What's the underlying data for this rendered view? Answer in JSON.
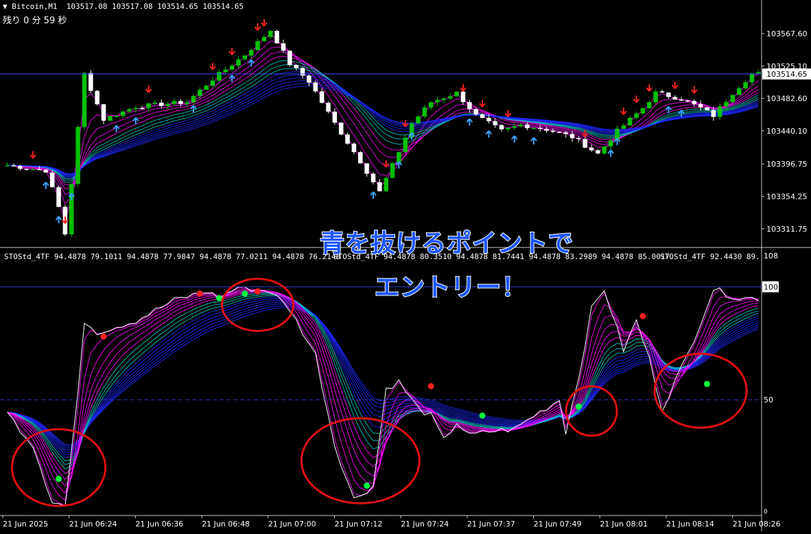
{
  "window": {
    "symbol_label": "Bitcoin,M1",
    "ohlc": "103517.08 103517.08 103514.65 103514.65",
    "timer": "残り 0 分 59 秒"
  },
  "indicator": {
    "label_1": "STOStd_4TF 94.4878 79.1011 94.4878 77.9847 94.4878 77.0211 94.4878 76.2148",
    "label_2": "STOStd_4TF 94.4878 80.3510 94.4878 81.7441 94.4878 83.2989 94.4878 85.0017",
    "label_3": "STOStd_4TF 92.4430 89."
  },
  "annotation": {
    "line1": "青を抜けるポイントで",
    "line2": "エントリー！"
  },
  "colors": {
    "background": "#000000",
    "bull": "#00c000",
    "bear": "#ffffff",
    "ma_fast": "#ff00ff",
    "ma_mid": "#00c8c8",
    "ma_slow": "#1e28ff",
    "circle": "#e01010",
    "dot_green": "#00ff40",
    "dot_red": "#ff2020",
    "callout_text": "#1e56ff"
  },
  "chart_data": [
    {
      "type": "candlestick",
      "symbol": "Bitcoin",
      "timeframe": "M1",
      "ylim": [
        103290,
        103608
      ],
      "y_ticks": [
        "103567.60",
        "103525.10",
        "103482.60",
        "103440.10",
        "103396.75",
        "103354.25",
        "103311.75"
      ],
      "current_price": "103514.65",
      "close_path": [
        [
          0,
          103395
        ],
        [
          6,
          103388
        ],
        [
          8,
          103340
        ],
        [
          9,
          103305
        ],
        [
          10,
          103372
        ],
        [
          12,
          103515
        ],
        [
          15,
          103455
        ],
        [
          20,
          103472
        ],
        [
          28,
          103478
        ],
        [
          32,
          103508
        ],
        [
          37,
          103540
        ],
        [
          41,
          103572
        ],
        [
          44,
          103528
        ],
        [
          47,
          103505
        ],
        [
          51,
          103450
        ],
        [
          55,
          103400
        ],
        [
          58,
          103360
        ],
        [
          60,
          103395
        ],
        [
          63,
          103450
        ],
        [
          66,
          103478
        ],
        [
          70,
          103490
        ],
        [
          73,
          103460
        ],
        [
          77,
          103440
        ],
        [
          80,
          103448
        ],
        [
          84,
          103442
        ],
        [
          88,
          103432
        ],
        [
          92,
          103410
        ],
        [
          95,
          103440
        ],
        [
          99,
          103470
        ],
        [
          101,
          103490
        ],
        [
          105,
          103482
        ],
        [
          108,
          103470
        ],
        [
          110,
          103460
        ],
        [
          113,
          103490
        ],
        [
          116,
          103515
        ]
      ],
      "buy_arrows": [
        6,
        8,
        10,
        17,
        20,
        29,
        35,
        38,
        57,
        61,
        63,
        72,
        75,
        79,
        82,
        94,
        95,
        103,
        105
      ],
      "sell_arrows": [
        4,
        9,
        22,
        32,
        35,
        39,
        40,
        59,
        62,
        71,
        74,
        78,
        90,
        96,
        98,
        100,
        104,
        107
      ]
    },
    {
      "type": "line",
      "name": "STOStd_4TF",
      "ylim": [
        0,
        108
      ],
      "y_ticks": [
        "108",
        "100",
        "50",
        "0"
      ],
      "x_ticks": [
        "21 Jun 2025",
        "21 Jun 06:24",
        "21 Jun 06:36",
        "21 Jun 06:48",
        "21 Jun 07:00",
        "21 Jun 07:12",
        "21 Jun 07:24",
        "21 Jun 07:37",
        "21 Jun 07:49",
        "21 Jun 08:01",
        "21 Jun 08:14",
        "21 Jun 08:26"
      ],
      "main_line_path": [
        [
          0,
          44
        ],
        [
          4,
          30
        ],
        [
          7,
          5
        ],
        [
          9,
          3
        ],
        [
          11,
          52
        ],
        [
          12,
          85
        ],
        [
          14,
          80
        ],
        [
          20,
          85
        ],
        [
          26,
          94
        ],
        [
          31,
          98
        ],
        [
          33,
          95
        ],
        [
          36,
          100
        ],
        [
          41,
          98
        ],
        [
          44,
          90
        ],
        [
          48,
          70
        ],
        [
          51,
          30
        ],
        [
          54,
          6
        ],
        [
          57,
          12
        ],
        [
          59,
          55
        ],
        [
          61,
          58
        ],
        [
          64,
          46
        ],
        [
          66,
          43
        ],
        [
          68,
          32
        ],
        [
          70,
          40
        ],
        [
          72,
          34
        ],
        [
          75,
          36
        ],
        [
          79,
          37
        ],
        [
          82,
          43
        ],
        [
          86,
          50
        ],
        [
          87,
          36
        ],
        [
          89,
          60
        ],
        [
          91,
          90
        ],
        [
          93,
          99
        ],
        [
          96,
          72
        ],
        [
          98,
          85
        ],
        [
          100,
          68
        ],
        [
          102,
          46
        ],
        [
          106,
          70
        ],
        [
          110,
          99
        ],
        [
          114,
          95
        ]
      ],
      "signal_dots": [
        {
          "index": 8,
          "value": 15,
          "color": "green"
        },
        {
          "index": 15,
          "value": 78,
          "color": "red"
        },
        {
          "index": 30,
          "value": 97,
          "color": "red"
        },
        {
          "index": 33,
          "value": 95,
          "color": "green"
        },
        {
          "index": 37,
          "value": 97,
          "color": "green"
        },
        {
          "index": 39,
          "value": 98,
          "color": "red"
        },
        {
          "index": 56,
          "value": 12,
          "color": "green"
        },
        {
          "index": 66,
          "value": 56,
          "color": "red"
        },
        {
          "index": 74,
          "value": 43,
          "color": "green"
        },
        {
          "index": 89,
          "value": 47,
          "color": "green"
        },
        {
          "index": 99,
          "value": 87,
          "color": "red"
        },
        {
          "index": 109,
          "value": 57,
          "color": "green"
        }
      ],
      "highlight_circles": [
        {
          "index": 8,
          "value": 20
        },
        {
          "index": 39,
          "value": 92
        },
        {
          "index": 55,
          "value": 23
        },
        {
          "index": 91,
          "value": 45
        },
        {
          "index": 108,
          "value": 54
        }
      ]
    }
  ]
}
